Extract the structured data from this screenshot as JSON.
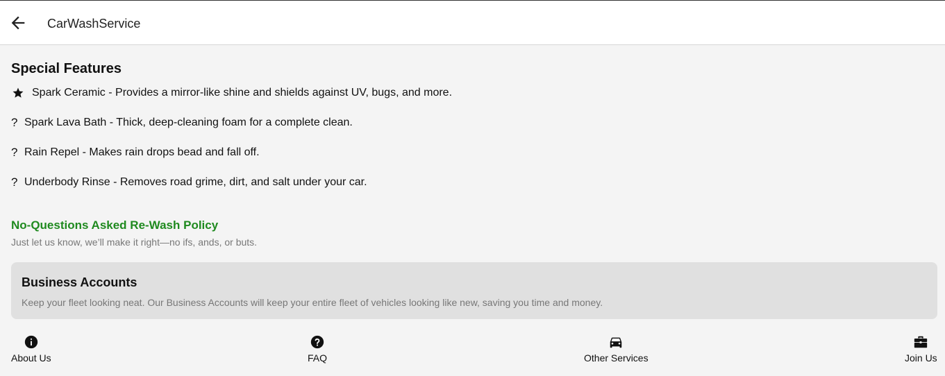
{
  "header": {
    "title": "CarWashService",
    "back_icon": "arrow-left-icon"
  },
  "special_features": {
    "title": "Special Features",
    "items": [
      {
        "icon": "star-icon",
        "text": "Spark Ceramic - Provides a mirror-like shine and shields against UV, bugs, and more."
      },
      {
        "icon": "?",
        "text": "Spark Lava Bath - Thick, deep-cleaning foam for a complete clean."
      },
      {
        "icon": "?",
        "text": "Rain Repel - Makes rain drops bead and fall off."
      },
      {
        "icon": "?",
        "text": "Underbody Rinse - Removes road grime, dirt, and salt under your car."
      }
    ]
  },
  "policy": {
    "title": "No-Questions Asked Re-Wash Policy",
    "description": "Just let us know, we’ll make it right—no ifs, ands, or buts.",
    "color": "#1f8a1f"
  },
  "business": {
    "title": "Business Accounts",
    "description": "Keep your fleet looking neat. Our Business Accounts will keep your entire fleet of vehicles looking like new, saving you time and money."
  },
  "bottom_nav": [
    {
      "label": "About Us",
      "icon": "info-icon"
    },
    {
      "label": "FAQ",
      "icon": "help-icon"
    },
    {
      "label": "Other Services",
      "icon": "car-icon"
    },
    {
      "label": "Join Us",
      "icon": "briefcase-icon"
    }
  ]
}
